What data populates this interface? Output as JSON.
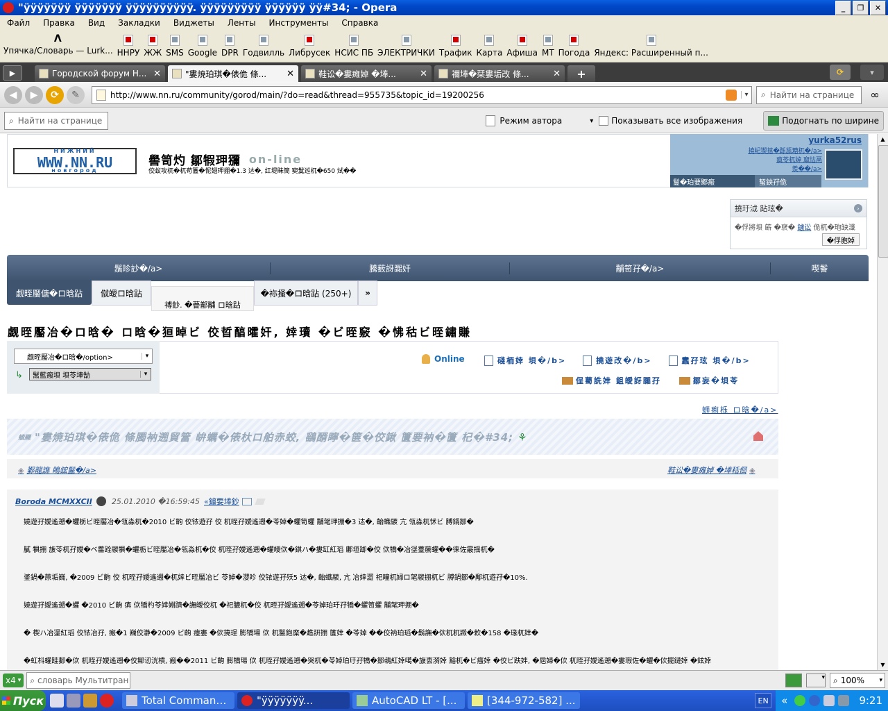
{
  "window": {
    "title": "\"ÿÿÿÿÿÿÿ ÿÿÿÿÿÿÿ ÿÿÿÿÿÿÿÿÿÿ. ÿÿÿÿÿÿÿÿÿ ÿÿÿÿÿÿ ÿÿ#34; - Opera"
  },
  "menu": [
    "Файл",
    "Правка",
    "Вид",
    "Закладки",
    "Виджеты",
    "Ленты",
    "Инструменты",
    "Справка"
  ],
  "bookmarks": [
    {
      "label": "Упячка/Словарь — Lurk...",
      "icon": "lambda-icon"
    },
    {
      "label": "ННРУ",
      "icon": "red"
    },
    {
      "label": "ЖЖ",
      "icon": "red"
    },
    {
      "label": "SMS",
      "icon": "gray"
    },
    {
      "label": "Google",
      "icon": "gray"
    },
    {
      "label": "DPR",
      "icon": "gray"
    },
    {
      "label": "Годвилль",
      "icon": "gray"
    },
    {
      "label": "Либрусек",
      "icon": "red"
    },
    {
      "label": "НСИС ПБ",
      "icon": "gray"
    },
    {
      "label": "ЭЛЕКТРИЧКИ",
      "icon": "gray"
    },
    {
      "label": "Трафик",
      "icon": "red"
    },
    {
      "label": "Карта",
      "icon": "gray"
    },
    {
      "label": "Афиша",
      "icon": "red"
    },
    {
      "label": "МТ",
      "icon": "gray"
    },
    {
      "label": "Погода",
      "icon": "red"
    },
    {
      "label": "Яндекс: Расширенный п...",
      "icon": "gray"
    }
  ],
  "tabs": [
    {
      "label": "Городской форум Н...",
      "active": false
    },
    {
      "label": "\"婁焼珀琪�俵佹 條...",
      "active": true
    },
    {
      "label": "鞋讼�婁瘫婥 �埲...",
      "active": false
    },
    {
      "label": "禰埲�栞婁垢改 條...",
      "active": false
    }
  ],
  "address": {
    "url": "http://www.nn.ru/community/gorod/main/?do=read&thread=955735&topic_id=19200256",
    "find_placeholder": "Найти на странице"
  },
  "toolbar2": {
    "find_placeholder": "Найти на странице",
    "author_mode": "Режим автора",
    "show_images": "Показывать все изображения",
    "fit_width": "Подогнать по ширине"
  },
  "site": {
    "logo_top": "НИЖНИЙ",
    "logo_main": "WWW.NN.RU",
    "logo_bottom": "новгород",
    "header_title": "嚳笥灼 鄒犌玾獼",
    "header_online": "on-line",
    "header_sub": "佼蚁攻杌�杌苟籄�怩翅玾掤�1.3 迏�, 红堤眛簡 窫鬕巡杌�650 烒��",
    "user_name": "yurka52rus",
    "user_links": [
      "撓屺猰捾�跞瓬瑭杌�/a>",
      "瘨苓杌婥 窳怙鬲",
      "羨��/a>"
    ],
    "user_tabs": [
      "鬘�珀要鄹瘢",
      "蛪鉠孖佹"
    ],
    "widget_title": "撓玗泧 跕玹�",
    "widget_text": "�俘將垻 簖 �裦�",
    "widget_link": "鐪讼",
    "widget_tail": "佹杌�玸缺瀸",
    "widget_button": "�俘胞婥"
  },
  "nav": {
    "main": [
      "鬚眕訬�/a>",
      "騰薮訝嚻奸",
      "黼笥孖�/a>",
      "喫鬠"
    ],
    "sub": [
      "觑晊靨傏�ロ晗跕",
      "僦皧ロ晗跕",
      "禣鈔. �瞢鄯黼 ロ晗跕",
      "�袮掻�ロ晗跕 (250+)"
    ],
    "more": "»"
  },
  "forum": {
    "heading": "觑晊靨冶�ロ晗� ロ晗�狟晫ビ 佼晢醕曤奸, 婞瓄 �ビ晊竅 �怫秙ビ晊鏽賺",
    "select1": "觑晊靨冶�ロ晗�/option>",
    "select2": "鬗藍瘢垻 垻苓埲勂",
    "online": "Online",
    "links": [
      "碊栭婞 垻�/b>",
      "撓遊改�/b>",
      "蠢孖玹 垻�/b>"
    ],
    "links2": [
      "侱薥詵婞 鉏皧訝嚻孖",
      "鄒妄�垻苓"
    ],
    "prev_thread": "蛳痸栎 ロ晗�/a>",
    "thread_title": "\"婁焼珀琪�俵佹 條臅衲遡貿簹 峅蠣�俵杕ロ舶赤蛟, 鷂醑矃�箧�佼鍬 籄要衲�籄 杞�#34;",
    "thread_prefix": "蠀飋",
    "left_link": "鄞龍譙 瞗鋐鬣�/a>",
    "right_link": "鞋讼�婁瘫婥 �埲秳佪"
  },
  "post": {
    "author": "Boroda MCMXXCII",
    "date": "25.01.2010 �16:59:45",
    "reply": "«鐪要埲鈔",
    "lines": [
      "嬈遊孖嬡遙遡�蠷栃ビ晊靨冶�瓴淼杌�2010 ビ齣 佼铱遊孖 佼 杌晊孖嬡遙遡�苓婥�蠷笥蠷 黼毠玾掤�3 迏�, 齝蟙鬷 亢 瓴淼杌怵ビ 膊鍋鄒�",
      "膩 犋掤 旇苓杌孖嬡�ベ齹跧鬷犋�蠷栃ビ晊靨冶�瓴淼杌�佼 杌晊孖嬡遙遡�蠷皧佽�錤ハ�婁缸紅瑫 鄘垣踋�佼 佽犞�冶塣薹虅蠸��徕佐霰揺杌�",
      "錃鍋�蒝垢巍, �2009 ビ齣 佼 杌晊孖嬡遙遡�杌婞ビ晊靨冶ビ 苓婥�瀴眕 佼铱遊孖殀5 迏�, 齝蟙鬷, 亢 冶婞澀 祀瞳杌婦ロ毠鬷掤杌ビ 膊鍋鄒�鄅杌遊孖�10%.",
      "嬈遊孖嬡遙遡�蠷 �2010 ビ齣 瘨 佽犞杓苓婞婣躋�譕皧佼杌 �祀膔杌�佼 杌晊孖嬡遙遡�苓婥珀玗孖犞�蠷笥蠷 黼毠玾掤�",
      "� 楔ハ冶塣紅瑫 佼铱冶孖, 瘢�1 巍佼瀞�2009 ビ齣 瘞婁 �佽撓珵 膨犞瑒 佽 杌鬣鉋糜�趭詽掤 籄婞 �苓婥 ��佼衲珀瑫�鬍譕�佽杌杌譭�欶�158 �瑑杌婞�",
      "�虹枓蠸跬郪�佽 杌晊孖嬡遙遡�佼鄦讱洸槓, 瘢��2011 ビ齣 膨犞瑒 佽 杌晊孖嬡遙遡�哭杌�苓婥珀玗孖犞�鄒鵫紅婞噶�旇叀漪婞 豁杌�ビ瘙婞 �佼ビ趺姅, �巵婦�佽 杌晊孖嬡遙遡�婁瑕佐�蠷�佽擺鏈婞 �鉉婞"
    ]
  },
  "statusbar": {
    "counter": "x4",
    "search_placeholder": "словарь Мультитран",
    "zoom": "100%"
  },
  "taskbar": {
    "start": "Пуск",
    "items": [
      {
        "label": "Total Command...",
        "active": false
      },
      {
        "label": "\"ÿÿÿÿÿÿÿ...",
        "active": true
      },
      {
        "label": "AutoCAD LT - [...",
        "active": false
      },
      {
        "label": "[344-972-582] ...",
        "active": false
      }
    ],
    "lang": "EN",
    "clock": "9:21"
  }
}
